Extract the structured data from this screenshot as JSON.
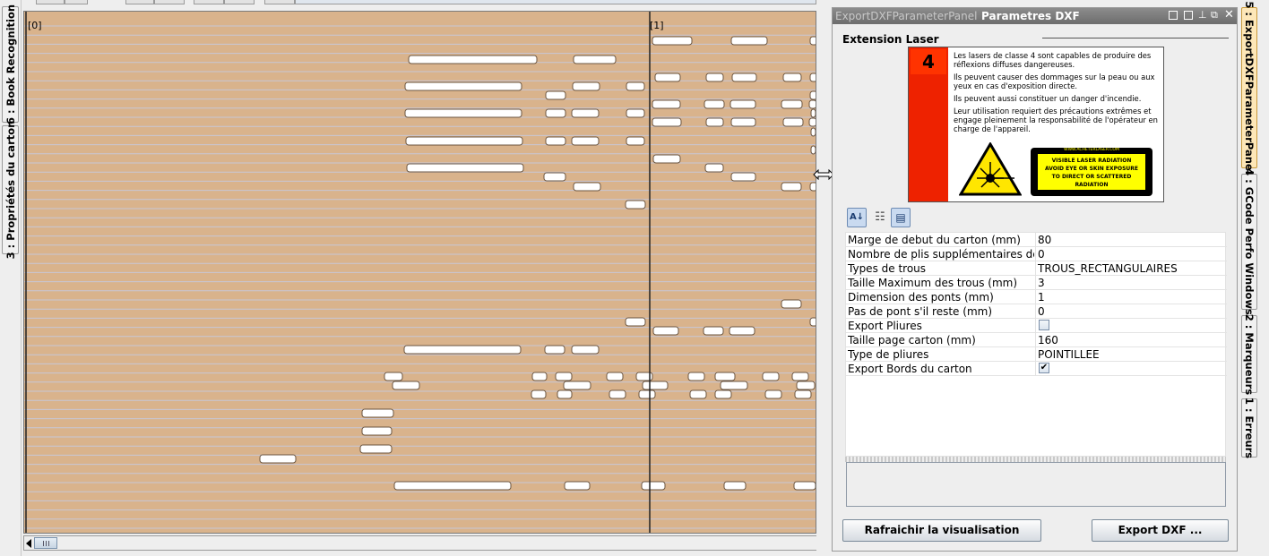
{
  "left_tabs": [
    {
      "label": "6 : Book Recognition"
    },
    {
      "label": "3 : Propriétés du carton"
    }
  ],
  "canvas": {
    "page_markers": [
      "[0]",
      "[1]"
    ],
    "colors": {
      "background": "#d9b38c",
      "lines": "#c7c7d6",
      "holes": "#ffffff"
    },
    "holes": [
      [
        727,
        40,
        44
      ],
      [
        815,
        40,
        40
      ],
      [
        903,
        40,
        8
      ],
      [
        455,
        61,
        143
      ],
      [
        639,
        61,
        47
      ],
      [
        730,
        81,
        28
      ],
      [
        787,
        81,
        19
      ],
      [
        816,
        81,
        27
      ],
      [
        873,
        81,
        20
      ],
      [
        903,
        81,
        8
      ],
      [
        451,
        91,
        130
      ],
      [
        638,
        91,
        30
      ],
      [
        698,
        91,
        20
      ],
      [
        608,
        101,
        22
      ],
      [
        903,
        101,
        8
      ],
      [
        727,
        111,
        31
      ],
      [
        785,
        111,
        22
      ],
      [
        814,
        111,
        28
      ],
      [
        871,
        111,
        23
      ],
      [
        902,
        111,
        8
      ],
      [
        451,
        121,
        130
      ],
      [
        608,
        121,
        22
      ],
      [
        637,
        121,
        30
      ],
      [
        698,
        121,
        20
      ],
      [
        904,
        121,
        5
      ],
      [
        727,
        131,
        32
      ],
      [
        787,
        131,
        19
      ],
      [
        815,
        131,
        27
      ],
      [
        873,
        131,
        22
      ],
      [
        902,
        131,
        8
      ],
      [
        904,
        142,
        5
      ],
      [
        452,
        152,
        130
      ],
      [
        608,
        152,
        22
      ],
      [
        637,
        152,
        30
      ],
      [
        698,
        152,
        20
      ],
      [
        728,
        172,
        30
      ],
      [
        904,
        162,
        5
      ],
      [
        453,
        182,
        130
      ],
      [
        786,
        182,
        20
      ],
      [
        606,
        192,
        24
      ],
      [
        815,
        192,
        27
      ],
      [
        639,
        203,
        30
      ],
      [
        871,
        203,
        22
      ],
      [
        903,
        203,
        8
      ],
      [
        697,
        223,
        22
      ],
      [
        871,
        334,
        22
      ],
      [
        697,
        354,
        22
      ],
      [
        903,
        354,
        8
      ],
      [
        728,
        364,
        28
      ],
      [
        784,
        364,
        22
      ],
      [
        813,
        364,
        28
      ],
      [
        450,
        385,
        130
      ],
      [
        607,
        385,
        22
      ],
      [
        637,
        385,
        30
      ],
      [
        428,
        415,
        20
      ],
      [
        593,
        415,
        16
      ],
      [
        619,
        415,
        18
      ],
      [
        676,
        415,
        18
      ],
      [
        709,
        415,
        18
      ],
      [
        767,
        415,
        18
      ],
      [
        797,
        415,
        22
      ],
      [
        850,
        415,
        18
      ],
      [
        883,
        415,
        18
      ],
      [
        437,
        425,
        30
      ],
      [
        628,
        425,
        30
      ],
      [
        716,
        425,
        28
      ],
      [
        803,
        425,
        30
      ],
      [
        888,
        425,
        20
      ],
      [
        592,
        435,
        16
      ],
      [
        621,
        435,
        16
      ],
      [
        679,
        435,
        18
      ],
      [
        712,
        435,
        18
      ],
      [
        769,
        435,
        18
      ],
      [
        797,
        435,
        18
      ],
      [
        853,
        435,
        18
      ],
      [
        886,
        435,
        18
      ],
      [
        403,
        456,
        35
      ],
      [
        403,
        476,
        33
      ],
      [
        401,
        496,
        35
      ],
      [
        289,
        507,
        40
      ],
      [
        439,
        537,
        130
      ],
      [
        629,
        537,
        28
      ],
      [
        715,
        537,
        26
      ],
      [
        807,
        537,
        24
      ],
      [
        885,
        537,
        24
      ]
    ]
  },
  "panel": {
    "tabs": [
      {
        "label": "ExportDXFParameterPanel"
      },
      {
        "label": "Parametres DXF"
      }
    ],
    "section_title": "Extension Laser",
    "laser_warning": {
      "class_number": "4",
      "paragraphs": [
        "Les lasers de classe 4 sont capables de produire des réflexions diffuses dangereuses.",
        "Ils peuvent causer des dommages sur la peau ou aux yeux en cas d'exposition directe.",
        "Ils peuvent aussi constituer un danger d'incendie.",
        "Leur utilisation requiert des précautions extrêmes et engage pleinement la responsabilité de l'opérateur en charge de l'appareil."
      ],
      "label_lines": [
        "VISIBLE LASER RADIATION",
        "AVOID EYE OR SKIN EXPOSURE",
        "TO DIRECT OR SCATTERED RADIATION",
        "CLASS 4 LASER PRODUCT"
      ],
      "label_border_text": "WWW.ACHETERLASER.COM",
      "colors": {
        "red": "#ee2200",
        "yellow": "#ffff00"
      }
    },
    "properties": [
      {
        "name": "Marge de debut du carton (mm)",
        "value": "80"
      },
      {
        "name": "Nombre de plis supplémentaires de...",
        "value": "0"
      },
      {
        "name": "Types de trous",
        "value": "TROUS_RECTANGULAIRES"
      },
      {
        "name": "Taille Maximum des trous (mm)",
        "value": "3"
      },
      {
        "name": "Dimension des ponts (mm)",
        "value": "1"
      },
      {
        "name": "Pas de pont s'il reste (mm)",
        "value": "0"
      },
      {
        "name": "Export Pliures",
        "checkbox": true,
        "checked": false
      },
      {
        "name": "Taille page carton (mm)",
        "value": "160"
      },
      {
        "name": "Type de pliures",
        "value": "POINTILLEE"
      },
      {
        "name": "Export Bords du carton",
        "checkbox": true,
        "checked": true
      }
    ],
    "buttons": {
      "refresh": "Rafraichir la visualisation",
      "export": "Export DXF ..."
    }
  },
  "right_tabs": [
    {
      "label": "5 : ExportDXFParameterPanel",
      "selected": true
    },
    {
      "label": "4 : GCode Perfo Windows"
    },
    {
      "label": "2 : Marqueurs"
    },
    {
      "label": "1 : Erreurs"
    }
  ]
}
